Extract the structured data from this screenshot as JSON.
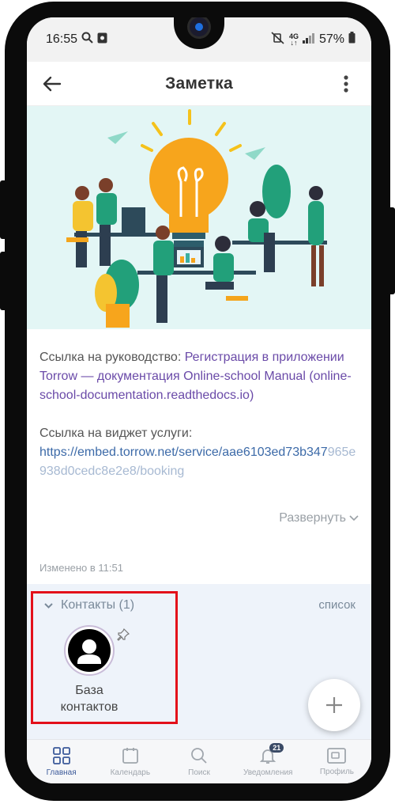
{
  "status_bar": {
    "time": "16:55",
    "network": "4G",
    "battery": "57%"
  },
  "header": {
    "title": "Заметка"
  },
  "note": {
    "guide_prefix": "Ссылка на руководство: ",
    "guide_link": "Регистрация в приложении Torrow — документация Online-school Manual",
    "guide_domain": " (online-school-documentation.readthedocs.io)",
    "widget_prefix": "Ссылка на виджет услуги:",
    "widget_url": "https://embed.torrow.net/service/aae6103ed73b347",
    "widget_url_fade": "965e938d0cedc8e2e8/booking",
    "expand_label": "Развернуть",
    "modified": "Изменено в 11:51"
  },
  "contacts": {
    "header": "Контакты (1)",
    "list_label": "список",
    "items": [
      {
        "name": "База контактов"
      }
    ]
  },
  "nav": {
    "items": [
      {
        "label": "Главная",
        "icon": "grid-icon"
      },
      {
        "label": "Календарь",
        "icon": "calendar-icon"
      },
      {
        "label": "Поиск",
        "icon": "search-icon"
      },
      {
        "label": "Уведомления",
        "icon": "bell-icon",
        "badge": "21"
      },
      {
        "label": "Профиль",
        "icon": "profile-icon"
      }
    ]
  },
  "colors": {
    "accent": "#3c5a9a",
    "link": "#6a4aa8",
    "highlight": "#e3101a"
  }
}
